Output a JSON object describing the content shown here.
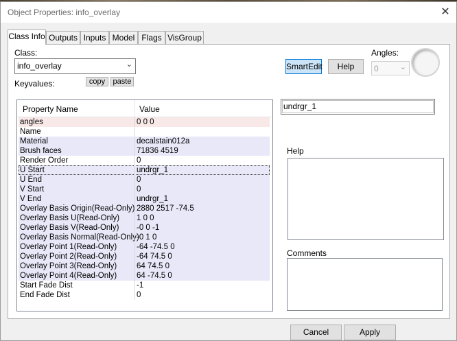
{
  "window": {
    "title": "Object Properties: info_overlay",
    "close_glyph": "✕"
  },
  "tabs": [
    "Class Info",
    "Outputs",
    "Inputs",
    "Model",
    "Flags",
    "VisGroup"
  ],
  "class_section": {
    "label": "Class:",
    "value": "info_overlay"
  },
  "keyvalues": {
    "label": "Keyvalues:",
    "copy": "copy",
    "paste": "paste"
  },
  "toolbar": {
    "smartedit": "SmartEdit",
    "help": "Help"
  },
  "angles": {
    "label": "Angles:",
    "value": "0"
  },
  "grid": {
    "header_name": "Property Name",
    "header_value": "Value",
    "rows": [
      {
        "key": "angles",
        "value": "0 0 0"
      },
      {
        "key": "Name",
        "value": ""
      },
      {
        "key": "Material",
        "value": "decalstain012a"
      },
      {
        "key": "Brush faces",
        "value": "71836 4519"
      },
      {
        "key": "Render Order",
        "value": "0"
      },
      {
        "key": "U Start",
        "value": "undrgr_1"
      },
      {
        "key": "U End",
        "value": "0"
      },
      {
        "key": "V Start",
        "value": "0"
      },
      {
        "key": "V End",
        "value": "undrgr_1"
      },
      {
        "key": "Overlay Basis Origin(Read-Only)",
        "value": "2880 2517 -74.5"
      },
      {
        "key": "Overlay Basis U(Read-Only)",
        "value": "1 0 0"
      },
      {
        "key": "Overlay Basis V(Read-Only)",
        "value": "-0 0 -1"
      },
      {
        "key": "Overlay Basis Normal(Read-Only)",
        "value": "-0 1 0"
      },
      {
        "key": "Overlay Point 1(Read-Only)",
        "value": "-64 -74.5 0"
      },
      {
        "key": "Overlay Point 2(Read-Only)",
        "value": "-64 74.5 0"
      },
      {
        "key": "Overlay Point 3(Read-Only)",
        "value": "64 74.5 0"
      },
      {
        "key": "Overlay Point 4(Read-Only)",
        "value": "64 -74.5 0"
      },
      {
        "key": "Start Fade Dist",
        "value": "-1"
      },
      {
        "key": "End Fade Dist",
        "value": "0"
      }
    ]
  },
  "value_edit": {
    "value": "undrgr_1"
  },
  "help_label": "Help",
  "comments_label": "Comments",
  "footer": {
    "cancel": "Cancel",
    "apply": "Apply"
  }
}
